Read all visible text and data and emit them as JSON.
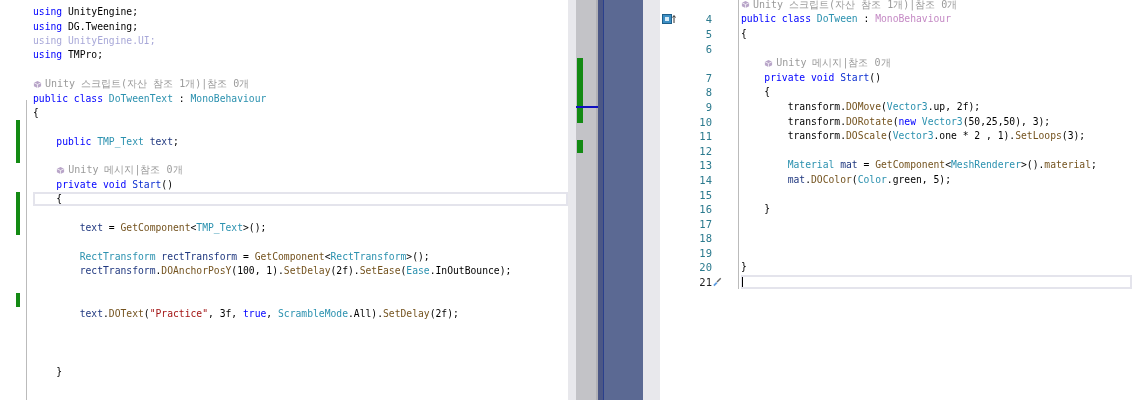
{
  "left_editor": {
    "lines": [
      {
        "kind": "code",
        "changed": false,
        "current": false,
        "tokens": [
          {
            "kind": "kw",
            "text": "using"
          },
          {
            "kind": "plain",
            "text": " UnityEngine;"
          }
        ]
      },
      {
        "kind": "code",
        "changed": false,
        "current": false,
        "tokens": [
          {
            "kind": "kw",
            "text": "using"
          },
          {
            "kind": "plain",
            "text": " DG.Tweening;"
          }
        ]
      },
      {
        "kind": "code",
        "changed": false,
        "current": false,
        "tokens": [
          {
            "kind": "faded",
            "text": "using UnityEngine.UI;"
          }
        ]
      },
      {
        "kind": "code",
        "changed": false,
        "current": false,
        "tokens": [
          {
            "kind": "kw",
            "text": "using"
          },
          {
            "kind": "plain",
            "text": " TMPro;"
          }
        ]
      },
      {
        "kind": "blank",
        "changed": false,
        "current": false
      },
      {
        "kind": "codelens",
        "changed": false,
        "current": false,
        "text": "Unity 스크립트(자산 참조 1개)|참조 0개"
      },
      {
        "kind": "code",
        "changed": false,
        "current": false,
        "tokens": [
          {
            "kind": "kw",
            "text": "public class "
          },
          {
            "kind": "type",
            "text": "DoTweenText"
          },
          {
            "kind": "plain",
            "text": " : "
          },
          {
            "kind": "type",
            "text": "MonoBehaviour"
          }
        ]
      },
      {
        "kind": "code",
        "changed": false,
        "current": false,
        "tokens": [
          {
            "kind": "plain",
            "text": "{"
          }
        ]
      },
      {
        "kind": "blank",
        "changed": true,
        "current": false
      },
      {
        "kind": "code",
        "changed": true,
        "current": false,
        "tokens": [
          {
            "kind": "kw",
            "text": "    public "
          },
          {
            "kind": "type",
            "text": "TMP_Text"
          },
          {
            "kind": "var",
            "text": " text"
          },
          {
            "kind": "plain",
            "text": ";"
          }
        ]
      },
      {
        "kind": "blank",
        "changed": true,
        "current": false
      },
      {
        "kind": "codelens",
        "changed": false,
        "current": false,
        "text": "Unity 메시지|참조 0개"
      },
      {
        "kind": "code",
        "changed": false,
        "current": false,
        "tokens": [
          {
            "kind": "kw",
            "text": "    private void "
          },
          {
            "kind": "member",
            "text": "Start"
          },
          {
            "kind": "plain",
            "text": "()"
          }
        ]
      },
      {
        "kind": "code",
        "changed": true,
        "current": true,
        "tokens": [
          {
            "kind": "plain",
            "text": "    {"
          }
        ]
      },
      {
        "kind": "blank",
        "changed": true,
        "current": false
      },
      {
        "kind": "code",
        "changed": true,
        "current": false,
        "tokens": [
          {
            "kind": "var",
            "text": "        text"
          },
          {
            "kind": "plain",
            "text": " = "
          },
          {
            "kind": "method",
            "text": "GetComponent"
          },
          {
            "kind": "plain",
            "text": "<"
          },
          {
            "kind": "type",
            "text": "TMP_Text"
          },
          {
            "kind": "plain",
            "text": ">();"
          }
        ]
      },
      {
        "kind": "blank",
        "changed": false,
        "current": false
      },
      {
        "kind": "code",
        "changed": false,
        "current": false,
        "tokens": [
          {
            "kind": "type",
            "text": "        RectTransform"
          },
          {
            "kind": "var",
            "text": " rectTransform"
          },
          {
            "kind": "plain",
            "text": " = "
          },
          {
            "kind": "method",
            "text": "GetComponent"
          },
          {
            "kind": "plain",
            "text": "<"
          },
          {
            "kind": "type",
            "text": "RectTransform"
          },
          {
            "kind": "plain",
            "text": ">();"
          }
        ]
      },
      {
        "kind": "code",
        "changed": false,
        "current": false,
        "tokens": [
          {
            "kind": "var",
            "text": "        rectTransform"
          },
          {
            "kind": "plain",
            "text": "."
          },
          {
            "kind": "method",
            "text": "DOAnchorPosY"
          },
          {
            "kind": "plain",
            "text": "(100, 1)."
          },
          {
            "kind": "method",
            "text": "SetDelay"
          },
          {
            "kind": "plain",
            "text": "(2f)."
          },
          {
            "kind": "method",
            "text": "SetEase"
          },
          {
            "kind": "plain",
            "text": "("
          },
          {
            "kind": "type",
            "text": "Ease"
          },
          {
            "kind": "plain",
            "text": ".InOutBounce);"
          }
        ]
      },
      {
        "kind": "blank",
        "changed": false,
        "current": false
      },
      {
        "kind": "blank",
        "changed": true,
        "current": false
      },
      {
        "kind": "code",
        "changed": false,
        "current": false,
        "tokens": [
          {
            "kind": "var",
            "text": "        text"
          },
          {
            "kind": "plain",
            "text": "."
          },
          {
            "kind": "method",
            "text": "DOText"
          },
          {
            "kind": "plain",
            "text": "("
          },
          {
            "kind": "str",
            "text": "\"Practice\""
          },
          {
            "kind": "plain",
            "text": ", 3f, "
          },
          {
            "kind": "kw",
            "text": "true"
          },
          {
            "kind": "plain",
            "text": ", "
          },
          {
            "kind": "type",
            "text": "ScrambleMode"
          },
          {
            "kind": "plain",
            "text": ".All)."
          },
          {
            "kind": "method",
            "text": "SetDelay"
          },
          {
            "kind": "plain",
            "text": "(2f);"
          }
        ]
      },
      {
        "kind": "blank",
        "changed": false,
        "current": false
      },
      {
        "kind": "blank",
        "changed": false,
        "current": false
      },
      {
        "kind": "blank",
        "changed": false,
        "current": false
      },
      {
        "kind": "code",
        "changed": false,
        "current": false,
        "tokens": [
          {
            "kind": "plain",
            "text": "    }"
          }
        ]
      },
      {
        "kind": "blank",
        "changed": false,
        "current": false
      }
    ]
  },
  "right_editor": {
    "lines": [
      {
        "kind": "codelens",
        "current": false,
        "text": "Unity 스크립트(자산 참조 1개)|참조 0개"
      },
      {
        "kind": "code",
        "number": "4",
        "current": false,
        "class_marker": true,
        "tokens": [
          {
            "kind": "kw",
            "text": "public class "
          },
          {
            "kind": "type",
            "text": "DoTween"
          },
          {
            "kind": "plain",
            "text": " : "
          },
          {
            "kind": "unresolved",
            "text": "MonoBehaviour"
          }
        ]
      },
      {
        "kind": "code",
        "number": "5",
        "current": false,
        "tokens": [
          {
            "kind": "plain",
            "text": "{"
          }
        ]
      },
      {
        "kind": "blank",
        "number": "6",
        "current": false
      },
      {
        "kind": "codelens",
        "current": false,
        "text": "Unity 메시지|참조 0개"
      },
      {
        "kind": "code",
        "number": "7",
        "current": false,
        "tokens": [
          {
            "kind": "kw",
            "text": "    private void "
          },
          {
            "kind": "member",
            "text": "Start"
          },
          {
            "kind": "plain",
            "text": "()"
          }
        ]
      },
      {
        "kind": "code",
        "number": "8",
        "current": false,
        "tokens": [
          {
            "kind": "plain",
            "text": "    {"
          }
        ]
      },
      {
        "kind": "code",
        "number": "9",
        "current": false,
        "tokens": [
          {
            "kind": "plain",
            "text": "        transform."
          },
          {
            "kind": "method",
            "text": "DOMove"
          },
          {
            "kind": "plain",
            "text": "("
          },
          {
            "kind": "type",
            "text": "Vector3"
          },
          {
            "kind": "plain",
            "text": ".up, 2f);"
          }
        ]
      },
      {
        "kind": "code",
        "number": "10",
        "current": false,
        "tokens": [
          {
            "kind": "plain",
            "text": "        transform."
          },
          {
            "kind": "method",
            "text": "DORotate"
          },
          {
            "kind": "plain",
            "text": "("
          },
          {
            "kind": "kw",
            "text": "new "
          },
          {
            "kind": "type",
            "text": "Vector3"
          },
          {
            "kind": "plain",
            "text": "(50,25,50), 3);"
          }
        ]
      },
      {
        "kind": "code",
        "number": "11",
        "current": false,
        "tokens": [
          {
            "kind": "plain",
            "text": "        transform."
          },
          {
            "kind": "method",
            "text": "DOScale"
          },
          {
            "kind": "plain",
            "text": "("
          },
          {
            "kind": "type",
            "text": "Vector3"
          },
          {
            "kind": "plain",
            "text": ".one * 2 , 1)."
          },
          {
            "kind": "method",
            "text": "SetLoops"
          },
          {
            "kind": "plain",
            "text": "(3);"
          }
        ]
      },
      {
        "kind": "blank",
        "number": "12",
        "current": false
      },
      {
        "kind": "code",
        "number": "13",
        "current": false,
        "tokens": [
          {
            "kind": "type",
            "text": "        Material"
          },
          {
            "kind": "var",
            "text": " mat"
          },
          {
            "kind": "plain",
            "text": " = "
          },
          {
            "kind": "method",
            "text": "GetComponent"
          },
          {
            "kind": "plain",
            "text": "<"
          },
          {
            "kind": "type",
            "text": "MeshRenderer"
          },
          {
            "kind": "plain",
            "text": ">()."
          },
          {
            "kind": "method",
            "text": "material"
          },
          {
            "kind": "plain",
            "text": ";"
          }
        ]
      },
      {
        "kind": "code",
        "number": "14",
        "current": false,
        "tokens": [
          {
            "kind": "var",
            "text": "        mat"
          },
          {
            "kind": "plain",
            "text": "."
          },
          {
            "kind": "method",
            "text": "DOColor"
          },
          {
            "kind": "plain",
            "text": "("
          },
          {
            "kind": "type",
            "text": "Color"
          },
          {
            "kind": "plain",
            "text": ".green, 5);"
          }
        ]
      },
      {
        "kind": "blank",
        "number": "15",
        "current": false
      },
      {
        "kind": "code",
        "number": "16",
        "current": false,
        "tokens": [
          {
            "kind": "plain",
            "text": "    }"
          }
        ]
      },
      {
        "kind": "blank",
        "number": "17",
        "current": false
      },
      {
        "kind": "blank",
        "number": "18",
        "current": false
      },
      {
        "kind": "blank",
        "number": "19",
        "current": false
      },
      {
        "kind": "code",
        "number": "20",
        "current": false,
        "tokens": [
          {
            "kind": "plain",
            "text": "}"
          }
        ]
      },
      {
        "kind": "blank",
        "number": "21",
        "current": true,
        "quick_action": true
      }
    ]
  }
}
